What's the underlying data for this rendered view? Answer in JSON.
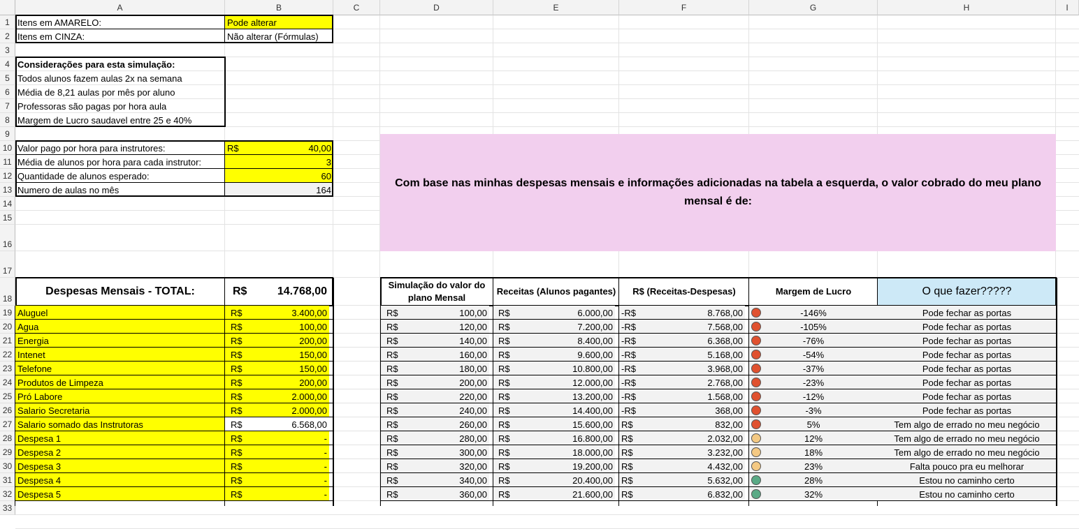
{
  "columns": [
    "A",
    "B",
    "C",
    "D",
    "E",
    "F",
    "G",
    "H",
    "I"
  ],
  "rows": [
    "1",
    "2",
    "3",
    "4",
    "5",
    "6",
    "7",
    "8",
    "9",
    "10",
    "11",
    "12",
    "13",
    "14",
    "15",
    "16",
    "17",
    "18",
    "19",
    "20",
    "21",
    "22",
    "23",
    "24",
    "25",
    "26",
    "27",
    "28",
    "29",
    "30",
    "31",
    "32",
    "33"
  ],
  "legend": {
    "yellow_label": "Itens em AMARELO:",
    "yellow_value": "Pode alterar",
    "gray_label": "Itens em CINZA:",
    "gray_value": "Não alterar (Fórmulas)"
  },
  "considerations": {
    "title": "Considerações para esta simulação:",
    "lines": [
      "Todos alunos fazem aulas 2x na semana",
      "Média de 8,21 aulas por mês por aluno",
      "Professoras são pagas por hora aula",
      "Margem de Lucro saudavel entre 25 e 40%"
    ]
  },
  "params": [
    {
      "label": "Valor pago por hora para instrutores:",
      "currency": "R$",
      "value": "40,00"
    },
    {
      "label": "Média de alunos por hora para cada instrutor:",
      "currency": "",
      "value": "3"
    },
    {
      "label": "Quantidade de alunos esperado:",
      "currency": "",
      "value": "60"
    },
    {
      "label": "Numero de aulas no mês",
      "currency": "",
      "value": "164"
    }
  ],
  "banner_text": "Com base nas minhas despesas mensais e informações adicionadas na tabela a esquerda, o valor cobrado do meu plano mensal é de:",
  "expenses": {
    "title": "Despesas Mensais - TOTAL:",
    "total_currency": "R$",
    "total_value": "14.768,00",
    "items": [
      {
        "label": "Aluguel",
        "currency": "R$",
        "value": "3.400,00"
      },
      {
        "label": "Agua",
        "currency": "R$",
        "value": "100,00"
      },
      {
        "label": "Energia",
        "currency": "R$",
        "value": "200,00"
      },
      {
        "label": "Intenet",
        "currency": "R$",
        "value": "150,00"
      },
      {
        "label": "Telefone",
        "currency": "R$",
        "value": "150,00"
      },
      {
        "label": "Produtos de Limpeza",
        "currency": "R$",
        "value": "200,00"
      },
      {
        "label": "Pró Labore",
        "currency": "R$",
        "value": "2.000,00"
      },
      {
        "label": "Salario Secretaria",
        "currency": "R$",
        "value": "2.000,00"
      },
      {
        "label": "Salario somado das Instrutoras",
        "currency": "R$",
        "value": "6.568,00"
      },
      {
        "label": "Despesa 1",
        "currency": "R$",
        "value": "-"
      },
      {
        "label": "Despesa 2",
        "currency": "R$",
        "value": "-"
      },
      {
        "label": "Despesa 3",
        "currency": "R$",
        "value": "-"
      },
      {
        "label": "Despesa 4",
        "currency": "R$",
        "value": "-"
      },
      {
        "label": "Despesa 5",
        "currency": "R$",
        "value": "-"
      }
    ]
  },
  "sim_table": {
    "headers": [
      "Simulação do valor do plano Mensal",
      "Receitas (Alunos pagantes)",
      "R$ (Receitas-Despesas)",
      "Margem de Lucro",
      "O que fazer?????"
    ],
    "rows": [
      {
        "plan_cur": "R$",
        "plan": "100,00",
        "rev_cur": "R$",
        "rev": "6.000,00",
        "res_cur": "-R$",
        "res": "8.768,00",
        "status": "red",
        "margin": "-146%",
        "action": "Pode fechar as portas"
      },
      {
        "plan_cur": "R$",
        "plan": "120,00",
        "rev_cur": "R$",
        "rev": "7.200,00",
        "res_cur": "-R$",
        "res": "7.568,00",
        "status": "red",
        "margin": "-105%",
        "action": "Pode fechar as portas"
      },
      {
        "plan_cur": "R$",
        "plan": "140,00",
        "rev_cur": "R$",
        "rev": "8.400,00",
        "res_cur": "-R$",
        "res": "6.368,00",
        "status": "red",
        "margin": "-76%",
        "action": "Pode fechar as portas"
      },
      {
        "plan_cur": "R$",
        "plan": "160,00",
        "rev_cur": "R$",
        "rev": "9.600,00",
        "res_cur": "-R$",
        "res": "5.168,00",
        "status": "red",
        "margin": "-54%",
        "action": "Pode fechar as portas"
      },
      {
        "plan_cur": "R$",
        "plan": "180,00",
        "rev_cur": "R$",
        "rev": "10.800,00",
        "res_cur": "-R$",
        "res": "3.968,00",
        "status": "red",
        "margin": "-37%",
        "action": "Pode fechar as portas"
      },
      {
        "plan_cur": "R$",
        "plan": "200,00",
        "rev_cur": "R$",
        "rev": "12.000,00",
        "res_cur": "-R$",
        "res": "2.768,00",
        "status": "red",
        "margin": "-23%",
        "action": "Pode fechar as portas"
      },
      {
        "plan_cur": "R$",
        "plan": "220,00",
        "rev_cur": "R$",
        "rev": "13.200,00",
        "res_cur": "-R$",
        "res": "1.568,00",
        "status": "red",
        "margin": "-12%",
        "action": "Pode fechar as portas"
      },
      {
        "plan_cur": "R$",
        "plan": "240,00",
        "rev_cur": "R$",
        "rev": "14.400,00",
        "res_cur": "-R$",
        "res": "368,00",
        "status": "red",
        "margin": "-3%",
        "action": "Pode fechar as portas"
      },
      {
        "plan_cur": "R$",
        "plan": "260,00",
        "rev_cur": "R$",
        "rev": "15.600,00",
        "res_cur": "R$",
        "res": "832,00",
        "status": "red",
        "margin": "5%",
        "action": "Tem algo de errado no meu negócio"
      },
      {
        "plan_cur": "R$",
        "plan": "280,00",
        "rev_cur": "R$",
        "rev": "16.800,00",
        "res_cur": "R$",
        "res": "2.032,00",
        "status": "yellow",
        "margin": "12%",
        "action": "Tem algo de errado no meu negócio"
      },
      {
        "plan_cur": "R$",
        "plan": "300,00",
        "rev_cur": "R$",
        "rev": "18.000,00",
        "res_cur": "R$",
        "res": "3.232,00",
        "status": "yellow",
        "margin": "18%",
        "action": "Tem algo de errado no meu negócio"
      },
      {
        "plan_cur": "R$",
        "plan": "320,00",
        "rev_cur": "R$",
        "rev": "19.200,00",
        "res_cur": "R$",
        "res": "4.432,00",
        "status": "yellow",
        "margin": "23%",
        "action": "Falta pouco pra eu melhorar"
      },
      {
        "plan_cur": "R$",
        "plan": "340,00",
        "rev_cur": "R$",
        "rev": "20.400,00",
        "res_cur": "R$",
        "res": "5.632,00",
        "status": "green",
        "margin": "28%",
        "action": "Estou no caminho certo"
      },
      {
        "plan_cur": "R$",
        "plan": "360,00",
        "rev_cur": "R$",
        "rev": "21.600,00",
        "res_cur": "R$",
        "res": "6.832,00",
        "status": "green",
        "margin": "32%",
        "action": "Estou no caminho certo"
      }
    ]
  },
  "colors": {
    "yellow": "#ffff00",
    "gray": "#f2f2f2",
    "banner": "#f2cfee",
    "header_blue": "#cde9f7",
    "status_red": "#e0512f",
    "status_yellow": "#f4c983",
    "status_green": "#5aaa86"
  }
}
